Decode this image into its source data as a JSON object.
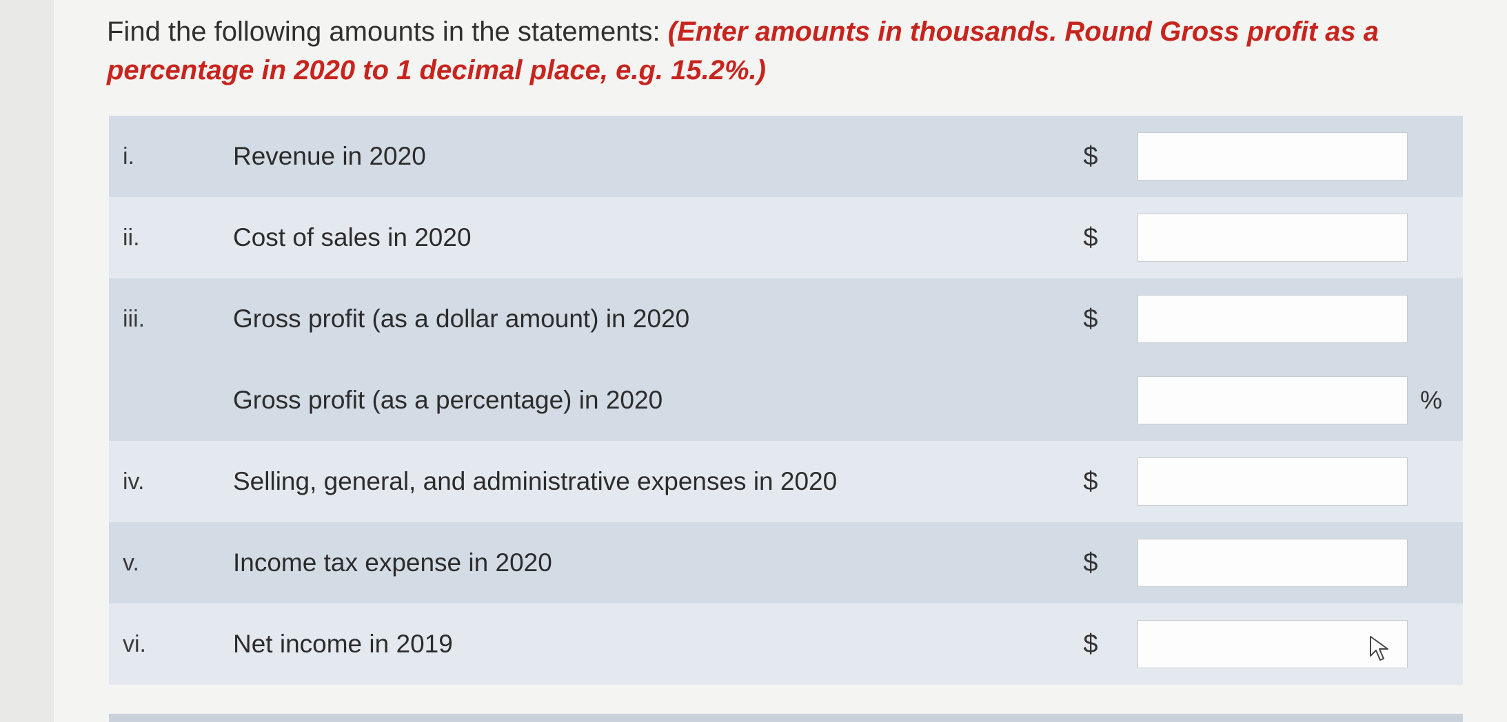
{
  "instructions": {
    "text": "Find the following amounts in the statements: ",
    "note": "(Enter amounts in thousands. Round Gross profit as a percentage in 2020 to 1 decimal place, e.g. 15.2%.)"
  },
  "rows": [
    {
      "numeral": "i.",
      "label": "Revenue in 2020",
      "currency": "$",
      "value": "",
      "suffix": ""
    },
    {
      "numeral": "ii.",
      "label": "Cost of sales in 2020",
      "currency": "$",
      "value": "",
      "suffix": ""
    },
    {
      "numeral": "iii.",
      "label": "Gross profit (as a dollar amount) in 2020",
      "currency": "$",
      "value": "",
      "suffix": ""
    },
    {
      "numeral": "",
      "label": "Gross profit (as a percentage) in 2020",
      "currency": "",
      "value": "",
      "suffix": "%"
    },
    {
      "numeral": "iv.",
      "label": "Selling, general, and administrative expenses in 2020",
      "currency": "$",
      "value": "",
      "suffix": ""
    },
    {
      "numeral": "v.",
      "label": "Income tax expense in 2020",
      "currency": "$",
      "value": "",
      "suffix": ""
    },
    {
      "numeral": "vi.",
      "label": "Net income in 2019",
      "currency": "$",
      "value": "",
      "suffix": ""
    }
  ],
  "colors": {
    "note": "#c8241e",
    "row_dark": "#d3dbe4",
    "row_light": "#e4e9ef"
  },
  "icons": {
    "cursor": "mouse-pointer-icon"
  }
}
